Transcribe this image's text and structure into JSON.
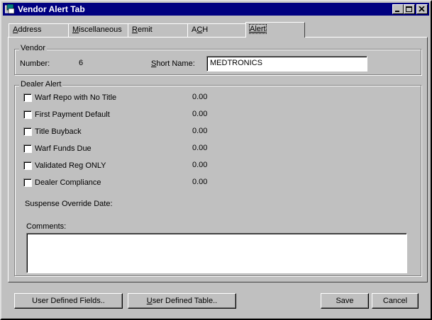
{
  "window": {
    "title": "Vendor Alert Tab",
    "minimize": "_",
    "maximize": "□",
    "close": "×"
  },
  "tabs": [
    {
      "label": "Address",
      "accel": "A",
      "rest": "ddress"
    },
    {
      "label": "Miscellaneous",
      "accel": "M",
      "rest": "iscellaneous"
    },
    {
      "label": "Remit",
      "accel": "R",
      "rest": "emit"
    },
    {
      "label": "ACH",
      "pre": "A",
      "accel": "C",
      "rest": "H"
    },
    {
      "label": "Alert",
      "accel": "Alert",
      "rest": ""
    }
  ],
  "vendor": {
    "group_label": "Vendor",
    "number_label": "Number:",
    "number_value": "6",
    "short_name_label_accel": "S",
    "short_name_label_rest": "hort Name:",
    "short_name_value": "MEDTRONICS"
  },
  "dealer_alert": {
    "group_label": "Dealer Alert",
    "items": [
      {
        "label": "Warf Repo with No Title",
        "value": "0.00"
      },
      {
        "label": "First Payment Default",
        "value": "0.00"
      },
      {
        "label": "Title Buyback",
        "value": "0.00"
      },
      {
        "label": "Warf Funds Due",
        "value": "0.00"
      },
      {
        "label": "Validated Reg ONLY",
        "value": "0.00"
      },
      {
        "label": "Dealer Compliance",
        "value": "0.00"
      }
    ],
    "suspense_label": "Suspense Override Date:",
    "comments_label": "Comments:",
    "comments_value": ""
  },
  "buttons": {
    "user_defined_fields": "User Defined Fields..",
    "user_defined_table": "User Defined Table..",
    "save": "Save",
    "cancel": "Cancel"
  }
}
